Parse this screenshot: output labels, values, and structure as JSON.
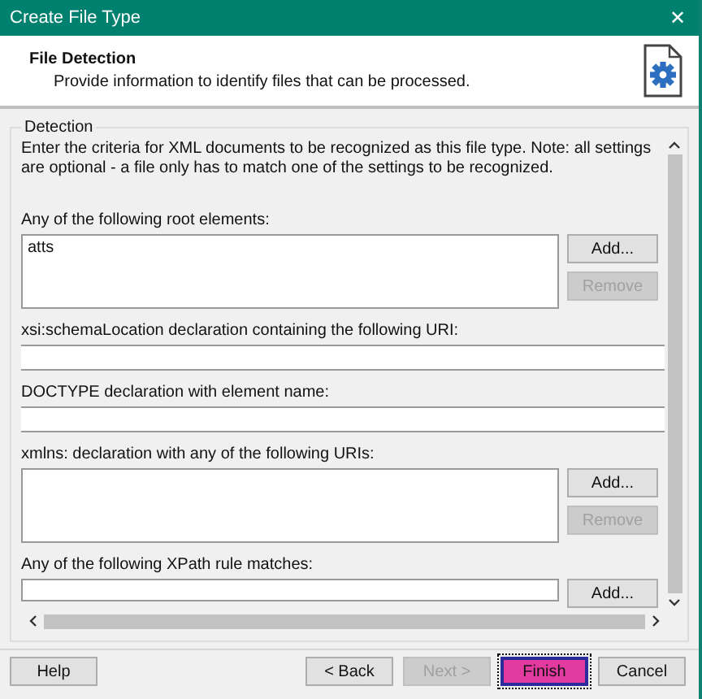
{
  "window": {
    "title": "Create File Type",
    "close": "✕"
  },
  "header": {
    "title": "File Detection",
    "description": "Provide information to identify files that can be processed."
  },
  "group": {
    "title": "Detection",
    "intro": "Enter the criteria for XML documents to be recognized as this file type. Note: all settings are optional - a file only has to match one of the settings to be recognized.",
    "sections": [
      {
        "kind": "list",
        "label": "Any of the following root elements:",
        "items": [
          "atts"
        ],
        "buttons": [
          {
            "label": "Add...",
            "disabled": false
          },
          {
            "label": "Remove",
            "disabled": true
          }
        ]
      },
      {
        "kind": "field",
        "label": "xsi:schemaLocation declaration containing the following URI:"
      },
      {
        "kind": "field",
        "label": "DOCTYPE declaration with element name:"
      },
      {
        "kind": "list",
        "label": "xmlns: declaration with any of the following URIs:",
        "buttons": [
          {
            "label": "Add...",
            "disabled": false
          },
          {
            "label": "Remove",
            "disabled": true
          }
        ]
      },
      {
        "kind": "partial",
        "label": "Any of the following XPath rule matches:",
        "buttons": [
          {
            "label": "Add...",
            "disabled": false
          }
        ]
      }
    ]
  },
  "footer": {
    "help": "Help",
    "buttons": [
      {
        "label": "< Back",
        "disabled": false,
        "selected": false
      },
      {
        "label": "Next >",
        "disabled": true,
        "selected": false
      },
      {
        "label": "Finish",
        "disabled": false,
        "selected": true
      },
      {
        "label": "Cancel",
        "disabled": false,
        "selected": false
      }
    ]
  }
}
